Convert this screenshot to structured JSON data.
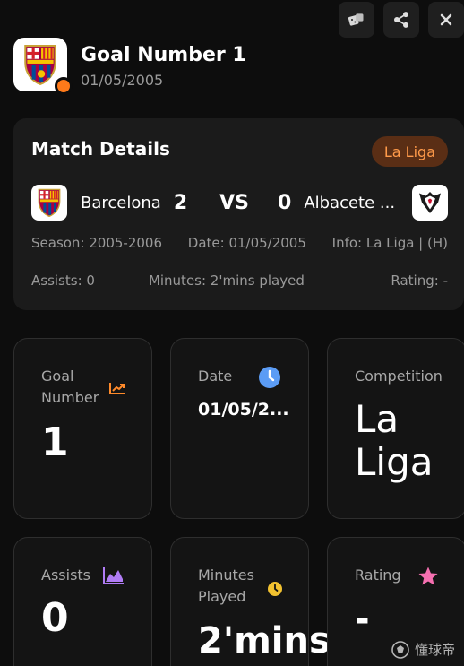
{
  "header": {
    "title": "Goal Number 1",
    "date": "01/05/2005"
  },
  "actions": {
    "icons": [
      "dice-icon",
      "share-icon",
      "close-icon"
    ]
  },
  "match": {
    "title": "Match Details",
    "league_badge": "La Liga",
    "home_team": "Barcelona",
    "home_score": "2",
    "vs_label": "VS",
    "away_score": "0",
    "away_team": "Albacete ...",
    "season": "Season: 2005-2006",
    "date": "Date: 01/05/2005",
    "info": "Info: La Liga | (H)",
    "assists": "Assists: 0",
    "minutes": "Minutes: 2'mins played",
    "rating": "Rating: -"
  },
  "stats": {
    "goal_number": {
      "label_line1": "Goal",
      "label_line2": "Number",
      "value": "1"
    },
    "date": {
      "label": "Date",
      "value": "01/05/2..."
    },
    "competition": {
      "label": "Competition",
      "value_line1": "La",
      "value_line2": "Liga"
    },
    "assists": {
      "label": "Assists",
      "value": "0"
    },
    "minutes": {
      "label_line1": "Minutes",
      "label_line2": "Played",
      "value": "2'mins"
    },
    "rating": {
      "label": "Rating",
      "value": "-"
    }
  },
  "colors": {
    "accent_orange": "#ff7a1a",
    "clock_blue": "#5b9cf5",
    "assists_purple": "#b07cf5",
    "minutes_yellow": "#f2c230",
    "rating_pink": "#f56fb0"
  },
  "watermark": {
    "text": "懂球帝"
  }
}
